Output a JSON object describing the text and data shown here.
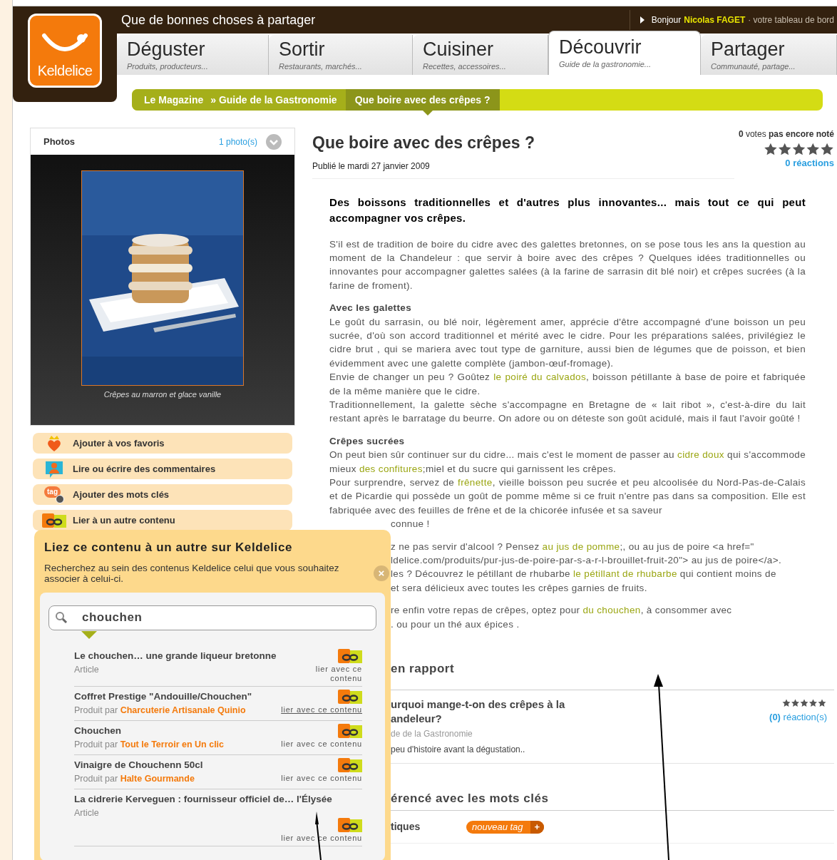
{
  "site": {
    "logo": "Keldelice",
    "tagline": "Que de bonnes choses à partager",
    "greeting": "Bonjour",
    "user": "Nicolas FAGET",
    "dashboard": "· votre tableau de bord"
  },
  "tabs": [
    {
      "label": "Déguster",
      "sub": "Produits, producteurs...",
      "selected": false
    },
    {
      "label": "Sortir",
      "sub": "Restaurants, marchés...",
      "selected": false
    },
    {
      "label": "Cuisiner",
      "sub": "Recettes, accessoires...",
      "selected": false
    },
    {
      "label": "Découvrir",
      "sub": "Guide de la gastronomie...",
      "selected": true
    },
    {
      "label": "Partager",
      "sub": "Communauté, partage...",
      "selected": false
    }
  ],
  "breadcrumb": [
    {
      "label": "Le Magazine",
      "selected": false
    },
    {
      "label": "» Guide de la Gastronomie",
      "selected": false
    },
    {
      "label": "Que boire avec des crêpes ?",
      "selected": true
    }
  ],
  "photos": {
    "title": "Photos",
    "count": "1 photo(s)",
    "caption": "Crêpes au marron et glace vanille"
  },
  "actions": [
    {
      "kind": "favorite",
      "label": "Ajouter à vos favoris"
    },
    {
      "kind": "comment",
      "label": "Lire ou écrire des commentaires"
    },
    {
      "kind": "tag",
      "label": "Ajouter des mots clés",
      "icon_text": "tag"
    },
    {
      "kind": "link",
      "label": "Lier à un autre contenu"
    }
  ],
  "article": {
    "title": "Que boire avec des crêpes ?",
    "published": "Publié le mardi 27 janvier 2009",
    "votes": "**0** votes **pas encore noté**",
    "reactions": "0 réactions",
    "lead": "Des boissons traditionnelles et d'autres plus innovantes... mais tout ce qui peut accompagner vos crêpes.",
    "blocks": [
      {
        "kind": "para",
        "parts": [
          {
            "kind": "text",
            "text": "S'il est de tradition de boire du cidre avec des galettes bretonnes, on se pose tous les ans la question au moment de la Chandeleur : que servir à boire avec des crêpes ? Quelques idées traditionnelles ou innovantes pour accompagner galettes salées (à la farine de sarrasin dit blé noir) et crêpes sucrées (à la farine de froment)."
          }
        ]
      },
      {
        "kind": "heading",
        "text": "Avec les galettes"
      },
      {
        "kind": "line",
        "parts": [
          {
            "kind": "text",
            "text": "Le goût du sarrasin, ou blé noir, légèrement amer, apprécie d'être accompagné d'une boisson un peu sucrée, d'où son accord traditionnel et mérité avec le cidre. Pour les préparations salées, privilégiez le cidre brut , qui se mariera avec tout type de garniture, aussi bien de légumes que de poisson, et bien évidemment avec une galette complète (jambon-œuf-fromage)."
          }
        ]
      },
      {
        "kind": "line",
        "parts": [
          {
            "kind": "text",
            "text": "Envie de changer un peu ? Goûtez "
          },
          {
            "kind": "link",
            "text": "le poiré du calvados"
          },
          {
            "kind": "text",
            "text": ", boisson pétillante à base de poire et fabriquée de la même manière que le cidre."
          }
        ]
      },
      {
        "kind": "para",
        "parts": [
          {
            "kind": "text",
            "text": "Traditionnellement, la galette sèche s'accompagne en Bretagne de « lait ribot », c'est-à-dire du lait restant après le barratage du beurre. On adore ou on déteste son goût acidulé, mais il faut l'avoir goûté !"
          }
        ]
      },
      {
        "kind": "heading",
        "text": "Crêpes sucrées"
      },
      {
        "kind": "line",
        "parts": [
          {
            "kind": "text",
            "text": "On peut bien sûr continuer sur du cidre... mais c'est le moment de passer au "
          },
          {
            "kind": "link",
            "text": "cidre doux"
          },
          {
            "kind": "text",
            "text": " qui s'accommode mieux "
          },
          {
            "kind": "link",
            "text": "des confitures"
          },
          {
            "kind": "text",
            "text": ";miel et du sucre qui garnissent les crêpes."
          }
        ]
      },
      {
        "kind": "line",
        "parts": [
          {
            "kind": "text",
            "text": "Pour surprendre, servez de "
          },
          {
            "kind": "link",
            "text": "frênette"
          },
          {
            "kind": "text",
            "text": ", vieille boisson peu sucrée et peu alcoolisée du Nord-Pas-de-Calais et de Picardie qui possède un goût de pomme même si ce fruit n'entre pas dans sa composition. Elle est fabriquée avec des feuilles de frêne et de la chicorée infusée et sa saveur"
          }
        ]
      },
      {
        "kind": "cut",
        "parts": [
          {
            "kind": "text",
            "text": "connue !"
          }
        ]
      },
      {
        "kind": "gap"
      },
      {
        "kind": "cut",
        "parts": [
          {
            "kind": "text",
            "text": "z ne pas servir d'alcool ? Pensez "
          },
          {
            "kind": "link",
            "text": "au jus de pomme"
          },
          {
            "kind": "text",
            "text": ";, ou au jus de poire <a href=\""
          }
        ]
      },
      {
        "kind": "cut",
        "parts": [
          {
            "kind": "text",
            "text": "ldelice.com/produits/pur-jus-de-poire-par-s-a-r-l-brouillet-fruit-20\"> au jus de poire</a>."
          }
        ]
      },
      {
        "kind": "cut",
        "parts": [
          {
            "kind": "text",
            "text": "les ? Découvrez le pétillant de rhubarbe "
          },
          {
            "kind": "link",
            "text": "le pétillant de rhubarbe"
          },
          {
            "kind": "text",
            "text": " qui contient moins de"
          }
        ]
      },
      {
        "kind": "cut",
        "parts": [
          {
            "kind": "text",
            "text": "et sera délicieux avec toutes les crêpes garnies de fruits."
          }
        ]
      },
      {
        "kind": "gap"
      },
      {
        "kind": "cut",
        "parts": [
          {
            "kind": "text",
            "text": "re enfin votre repas de crêpes, optez pour "
          },
          {
            "kind": "link",
            "text": "du chouchen"
          },
          {
            "kind": "text",
            "text": ", à consommer avec"
          }
        ]
      },
      {
        "kind": "cut",
        "parts": [
          {
            "kind": "text",
            "text": ". ou pour un thé aux épices ."
          }
        ]
      }
    ]
  },
  "related": {
    "title": "en rapport",
    "items": [
      {
        "title": "urquoi mange-t-on des crêpes à la andeleur?",
        "category": "de de la Gastronomie",
        "excerpt": "peu d'histoire  avant la dégustation..",
        "count": "(0)",
        "reactions": "réaction(s)"
      }
    ]
  },
  "keywords": {
    "title": "érencé avec les mots clés",
    "rows": [
      {
        "label": "tiques",
        "button": "nouveau tag",
        "plus": "+"
      }
    ]
  },
  "link_popup": {
    "title": "Liez ce contenu à un autre sur Keldelice",
    "description": "Recherchez au sein des contenus Keldelice celui que vous souhaitez associer à celui-ci.",
    "close": "×",
    "search": {
      "value": "chouchen"
    },
    "results": [
      {
        "title": "Le chouchen… une grande liqueur bretonne",
        "type": "Article",
        "link": "lier avec ce contenu",
        "hovered": false
      },
      {
        "title": "Coffret Prestige \"Andouille/Chouchen\"",
        "type": "Produit par",
        "producer": "Charcuterie Artisanale Quinio",
        "link": "lier avec ce contenu",
        "hovered": true
      },
      {
        "title": "Chouchen",
        "type": "Produit par",
        "producer": "Tout le Terroir en Un clic",
        "link": "lier avec ce contenu",
        "hovered": false
      },
      {
        "title": "Vinaigre de Chouchenn 50cl",
        "type": "Produit par",
        "producer": "Halte Gourmande",
        "link": "lier avec ce contenu",
        "hovered": false
      },
      {
        "title": "La cidrerie Kerveguen : fournisseur officiel de… l'Élysée",
        "type": "Article",
        "link": "lier avec ce contenu",
        "hovered": false
      }
    ]
  }
}
